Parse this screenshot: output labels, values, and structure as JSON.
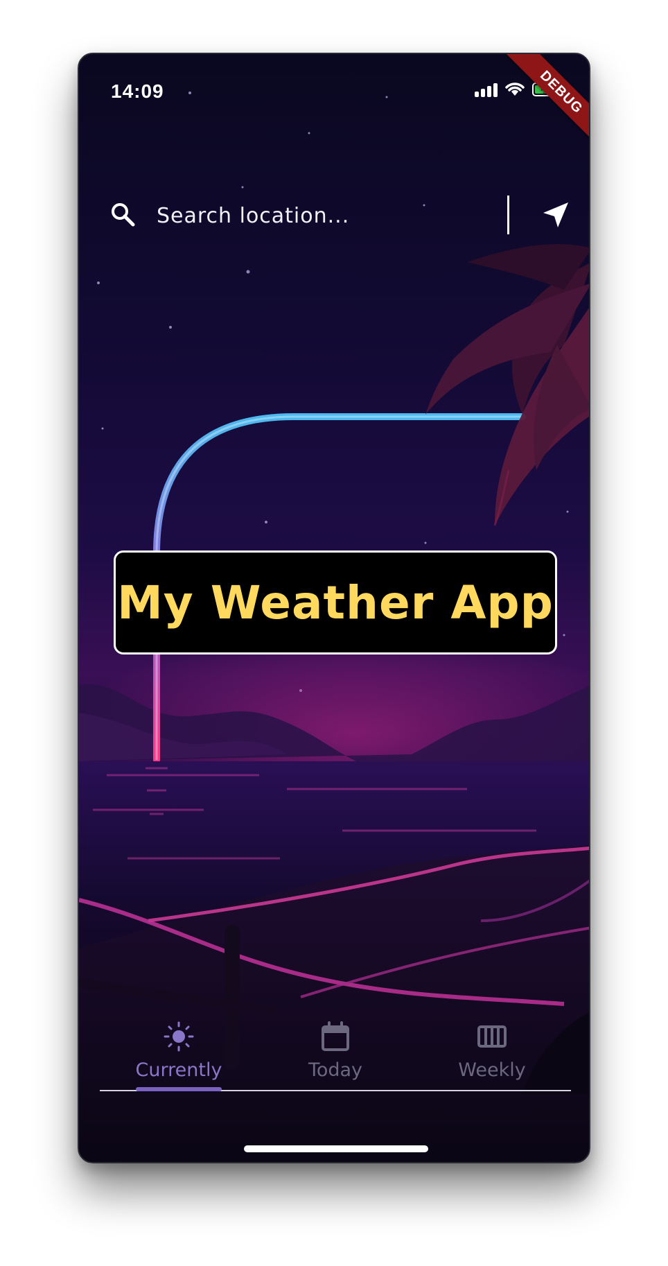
{
  "status_bar": {
    "time": "14:09",
    "debug_label": "DEBUG"
  },
  "search": {
    "placeholder": "Search location..."
  },
  "title": {
    "text": "My Weather App"
  },
  "bottom_nav": {
    "items": [
      {
        "label": "Currently",
        "icon": "sun-icon",
        "active": true
      },
      {
        "label": "Today",
        "icon": "calendar-icon",
        "active": false
      },
      {
        "label": "Weekly",
        "icon": "calendar-week-icon",
        "active": false
      }
    ]
  },
  "colors": {
    "title_text": "#ffd95e",
    "active_tab": "#8b77c9",
    "inactive_tab": "#6b6880",
    "neon_cyan": "#4fc3f7",
    "neon_pink": "#e83e8c",
    "debug_ribbon": "#8e1616"
  }
}
